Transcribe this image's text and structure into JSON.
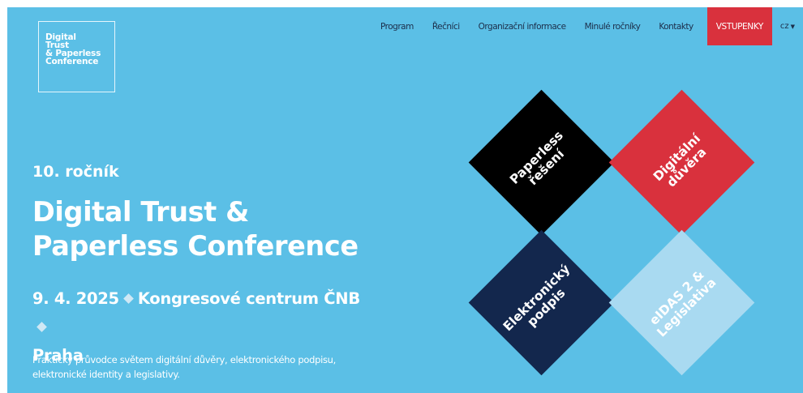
{
  "logo": {
    "lines": [
      "Digital",
      "Trust",
      "& Paperless",
      "Conference"
    ]
  },
  "nav": {
    "items": [
      "Program",
      "Řečníci",
      "Organizační informace",
      "Minulé ročníky",
      "Kontakty"
    ],
    "cta": "VSTUPENKY",
    "lang": "cz"
  },
  "hero": {
    "edition": "10. ročník",
    "title_line1": "Digital Trust &",
    "title_line2": "Paperless Conference",
    "date": "9. 4. 2025",
    "venue": "Kongresové centrum ČNB",
    "city": "Praha",
    "description_line1": "Praktický průvodce světem digitální důvěry, elektronického podpisu,",
    "description_line2": "elektronické identity a legislativy."
  },
  "tiles": [
    {
      "id": "paperless",
      "lines": [
        "Paperless",
        "řešení"
      ],
      "color": "#000000"
    },
    {
      "id": "digitalni",
      "lines": [
        "Digitální",
        "důvěra"
      ],
      "color": "#d9313d"
    },
    {
      "id": "elektronicky",
      "lines": [
        "Elektronický",
        "podpis"
      ],
      "color": "#13274d"
    },
    {
      "id": "eidas",
      "lines": [
        "eIDAS 2 &",
        "Legislativa"
      ],
      "color": "#a9daf1"
    }
  ],
  "colors": {
    "background": "#5bbfe6",
    "accent": "#d9313d",
    "nav_text": "#1c2e4a"
  }
}
